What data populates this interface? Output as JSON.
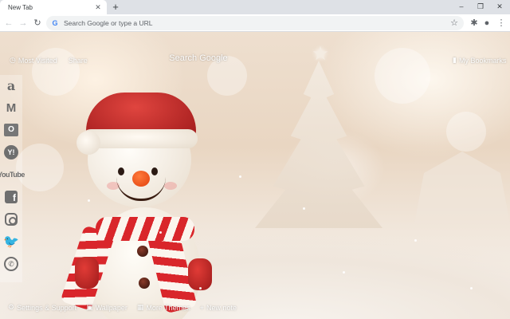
{
  "browser": {
    "tab_title": "New Tab",
    "tab_close": "✕",
    "new_tab": "+",
    "win_min": "–",
    "win_max": "❐",
    "win_close": "✕",
    "back": "←",
    "forward": "→",
    "reload": "↻",
    "omnibox_g": "G",
    "omnibox_placeholder": "Search Google or type a URL",
    "star": "☆",
    "extensions": "✱",
    "profile": "●",
    "menu": "⋮"
  },
  "overlay": {
    "most_visited_icon": "◷",
    "most_visited": "Most Visited",
    "share": "Share",
    "search_google": "Search Google",
    "bookmarks_icon": "▮",
    "bookmarks": "My Bookmarks"
  },
  "sidebar": {
    "items": [
      {
        "name": "amazon",
        "glyph": "a"
      },
      {
        "name": "gmail",
        "glyph": "M"
      },
      {
        "name": "outlook",
        "glyph": "O"
      },
      {
        "name": "yahoo",
        "glyph": "Y!"
      },
      {
        "name": "youtube",
        "glyph": "YouTube"
      },
      {
        "name": "facebook",
        "glyph": "f"
      },
      {
        "name": "instagram",
        "glyph": ""
      },
      {
        "name": "twitter",
        "glyph": "🐦"
      },
      {
        "name": "whatsapp",
        "glyph": "✆"
      }
    ]
  },
  "bottom": {
    "settings_icon": "⚙",
    "settings": "Settings & Support",
    "wallpaper_icon": "▣",
    "wallpaper": "Wallpaper",
    "themes_icon": "▦",
    "themes": "More Themes",
    "note_icon": "+",
    "note": "New note"
  },
  "colors": {
    "accent_red": "#d9262b",
    "chrome_bg": "#dee1e6"
  }
}
